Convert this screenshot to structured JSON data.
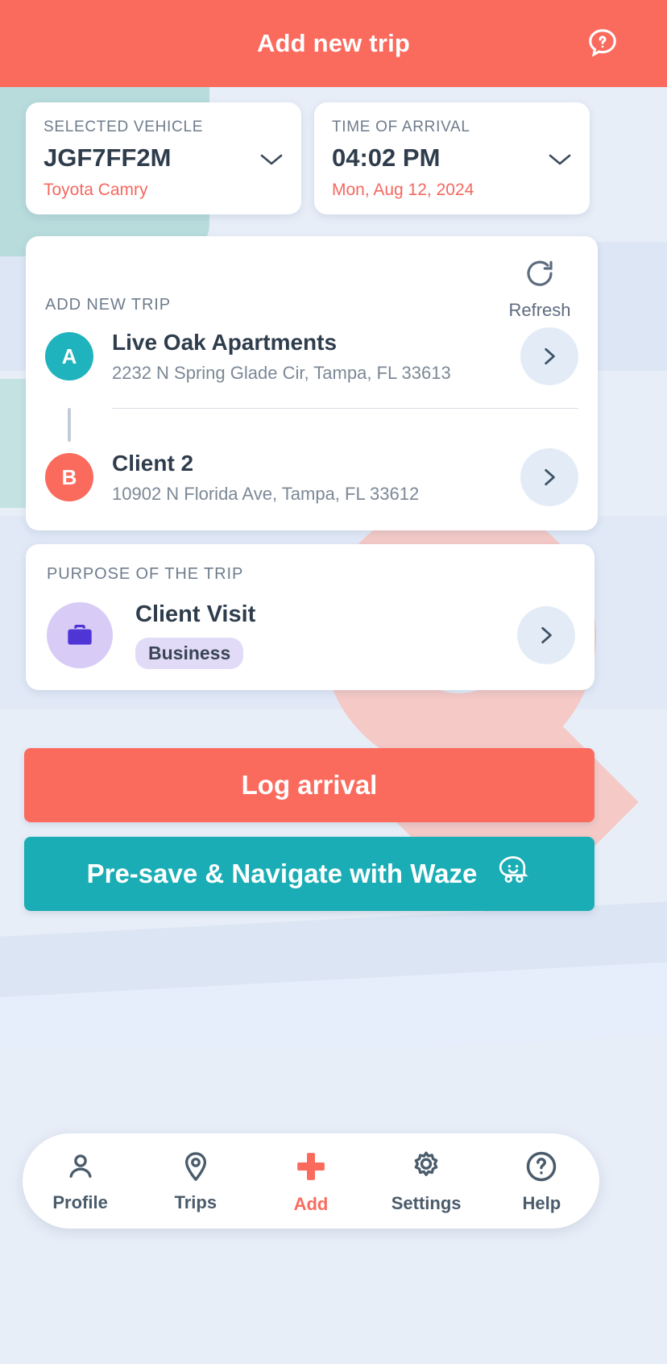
{
  "header": {
    "title": "Add new trip",
    "help_icon": "help-chat-icon",
    "background_color": "#fa6b5e"
  },
  "selectors": [
    {
      "label": "SELECTED VEHICLE",
      "value": "JGF7FF2M",
      "sub": "Toyota Camry",
      "chevron": "chevron-down-icon"
    },
    {
      "label": "TIME OF ARRIVAL",
      "value": "04:02 PM",
      "sub": "Mon, Aug 12, 2024",
      "chevron": "chevron-down-icon"
    }
  ],
  "trip": {
    "section_label": "ADD NEW TRIP",
    "refresh_label": "Refresh",
    "refresh_icon": "refresh-icon",
    "stops": [
      {
        "marker": "A",
        "marker_color": "#1fb3bd",
        "name": "Live Oak Apartments",
        "address": "2232 N Spring Glade Cir, Tampa,  FL 33613",
        "chevron": "chevron-right-icon"
      },
      {
        "marker": "B",
        "marker_color": "#fa6b5e",
        "name": "Client 2",
        "address": "10902 N Florida Ave, Tampa,  FL 33612",
        "chevron": "chevron-right-icon"
      }
    ]
  },
  "purpose": {
    "section_label": "PURPOSE OF THE TRIP",
    "icon": "briefcase-icon",
    "name": "Client Visit",
    "badge": "Business",
    "chevron": "chevron-right-icon"
  },
  "actions": {
    "log_arrival": "Log arrival",
    "waze": "Pre-save & Navigate with Waze",
    "waze_icon": "waze-smiley-icon",
    "log_arrival_color": "#fa6b5e",
    "waze_color": "#1aadb5"
  },
  "bottom_nav": {
    "items": [
      {
        "label": "Profile",
        "icon": "person-icon",
        "active": false
      },
      {
        "label": "Trips",
        "icon": "map-pin-icon",
        "active": false
      },
      {
        "label": "Add",
        "icon": "plus-icon",
        "active": true
      },
      {
        "label": "Settings",
        "icon": "gear-icon",
        "active": false
      },
      {
        "label": "Help",
        "icon": "question-circle-icon",
        "active": false
      }
    ],
    "active_color": "#fa6b5e"
  }
}
